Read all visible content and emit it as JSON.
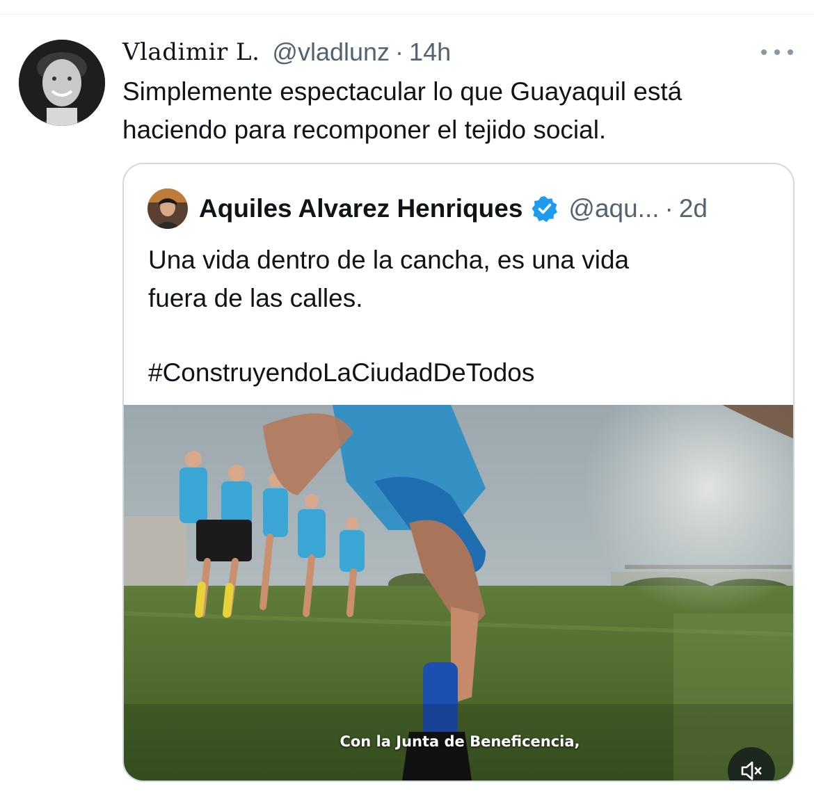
{
  "tweet": {
    "display_name": "Vladimir L.",
    "handle": "@vladlunz",
    "separator": "·",
    "time": "14h",
    "more_icon": "more-horizontal-icon",
    "text_line1": "Simplemente espectacular lo que Guayaquil está",
    "text_line2": "haciendo para recomponer el tejido social."
  },
  "quote": {
    "display_name": "Aquiles Alvarez Henriques",
    "verified_icon": "verified-badge-icon",
    "handle": "@aqu...",
    "separator": "·",
    "time": "2d",
    "text_line1": "Una vida dentro de la cancha, es una vida",
    "text_line2": "fuera de las calles.",
    "hashtag": "#ConstruyendoLaCiudadDeTodos",
    "video": {
      "caption": "Con la Junta de Beneficencia,",
      "mute_icon": "volume-muted-icon"
    }
  },
  "colors": {
    "text_primary": "#0f1419",
    "text_secondary": "#536471",
    "border": "#cfd9de",
    "verified_blue": "#1d9bf0"
  }
}
